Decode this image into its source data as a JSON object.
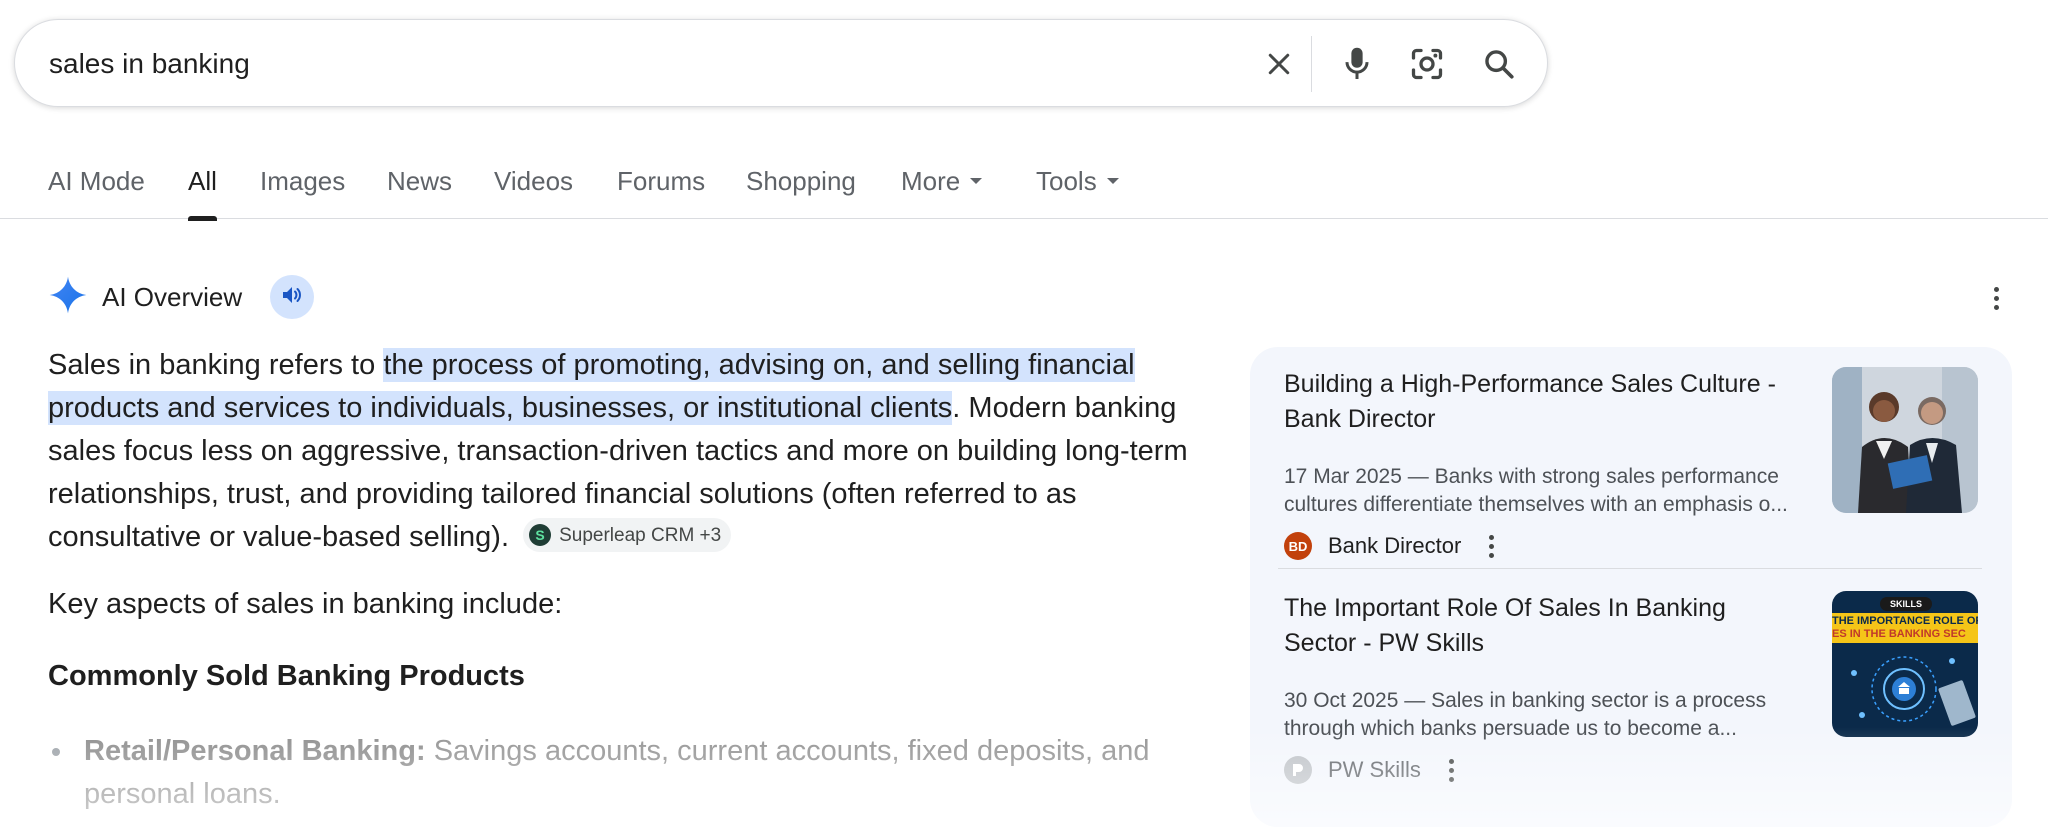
{
  "search": {
    "query": "sales in banking",
    "clear_icon": "close-icon",
    "voice_icon": "mic-icon",
    "lens_icon": "camera-lens-icon",
    "search_icon": "search-icon"
  },
  "tabs": [
    {
      "label": "AI Mode"
    },
    {
      "label": "All",
      "active": true
    },
    {
      "label": "Images"
    },
    {
      "label": "News"
    },
    {
      "label": "Videos"
    },
    {
      "label": "Forums"
    },
    {
      "label": "Shopping"
    },
    {
      "label": "More"
    },
    {
      "label": "Tools"
    }
  ],
  "ai_overview": {
    "title": "AI Overview",
    "intro": "Sales in banking refers to ",
    "highlight": "the process of promoting, advising on, and selling financial products and services to individuals, businesses, or institutional clients",
    "rest": ". Modern banking sales focus less on aggressive, transaction-driven tactics and more on building long-term relationships, trust, and providing tailored financial solutions (often referred to as consultative or value-based selling).",
    "source_chip": "Superleap CRM +3",
    "key_aspects": "Key aspects of sales in banking include:",
    "section_heading": "Commonly Sold Banking Products",
    "bullet_label": "Retail/Personal Banking:",
    "bullet_text": " Savings accounts, current accounts, fixed deposits, and personal loans."
  },
  "sources": [
    {
      "title": "Building a High-Performance Sales Culture - Bank Director",
      "snippet_line1": "17 Mar 2025 — Banks with strong sales performance",
      "snippet_line2": "cultures differentiate themselves with an emphasis o...",
      "site": "Bank Director",
      "favicon_text": "BD"
    },
    {
      "title": "The Important Role Of Sales In Banking Sector - PW Skills",
      "snippet_line1": "30 Oct 2025 — Sales in banking sector is a process",
      "snippet_line2": "through which banks persuade us to become a...",
      "site": "PW Skills",
      "thumb_badge": "SKILLS",
      "thumb_line1": "THE IMPORTANCE ROLE OF",
      "thumb_line2": "ES IN THE BANKING SEC"
    }
  ],
  "colors": {
    "highlight": "#d3e3fd",
    "panel_bg": "#f3f6fc",
    "gemini_blue": "#4285f4"
  }
}
